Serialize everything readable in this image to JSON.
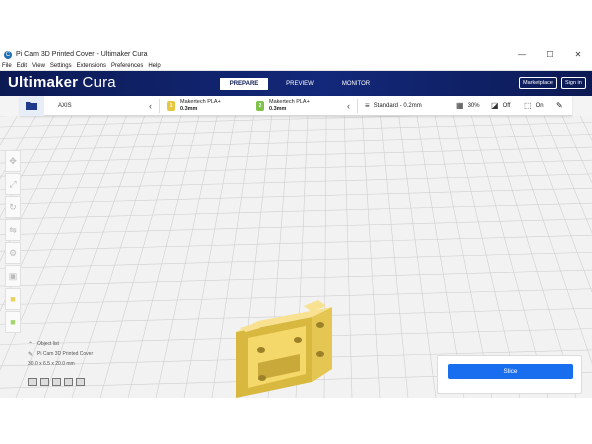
{
  "window": {
    "title": "Pi Cam 3D Printed Cover - Ultimaker Cura",
    "controls": {
      "minimize": "—",
      "maximize": "☐",
      "close": "✕"
    }
  },
  "menu": [
    "File",
    "Edit",
    "View",
    "Settings",
    "Extensions",
    "Preferences",
    "Help"
  ],
  "header": {
    "brand_bold": "Ultimaker",
    "brand_light": " Cura",
    "tabs": [
      {
        "label": "PREPARE",
        "active": true
      },
      {
        "label": "PREVIEW",
        "active": false
      },
      {
        "label": "MONITOR",
        "active": false
      }
    ],
    "marketplace": "Marketplace",
    "signin": "Sign in"
  },
  "toolbar": {
    "machine": "AXIS",
    "extruders": [
      {
        "number": "1",
        "material": "Makertech PLA+",
        "nozzle": "0.3mm",
        "color": "#e6c840"
      },
      {
        "number": "2",
        "material": "Makertech PLA+",
        "nozzle": "0.3mm",
        "color": "#7fc24a"
      }
    ],
    "profile": "Standard - 0.2mm",
    "infill": "30%",
    "support": "Off",
    "adhesion": "On"
  },
  "object": {
    "list_label": "Object list",
    "name": "Pi Cam 3D Printed Cover",
    "dimensions": "30.0 x 6.5 x 20.0 mm"
  },
  "slice": {
    "label": "Slice"
  },
  "colors": {
    "header": "#0c1a54",
    "accent": "#196ef0",
    "model": "#f5d86a"
  }
}
